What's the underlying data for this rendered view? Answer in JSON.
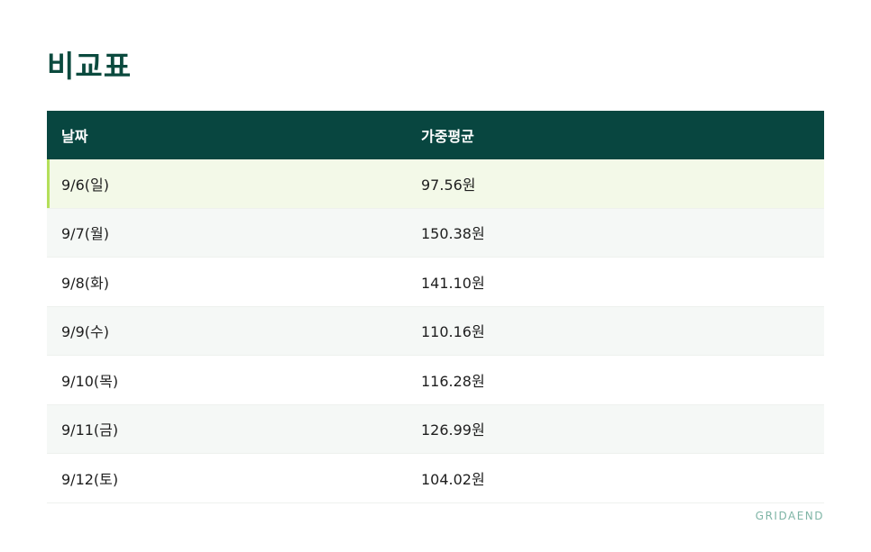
{
  "page": {
    "title": "비교표",
    "brand": "GRIDAEND"
  },
  "table": {
    "headers": {
      "date": "날짜",
      "avg": "가중평균"
    },
    "rows": [
      {
        "date": "9/6(일)",
        "avg": "97.56원"
      },
      {
        "date": "9/7(월)",
        "avg": "150.38원"
      },
      {
        "date": "9/8(화)",
        "avg": "141.10원"
      },
      {
        "date": "9/9(수)",
        "avg": "110.16원"
      },
      {
        "date": "9/10(목)",
        "avg": "116.28원"
      },
      {
        "date": "9/11(금)",
        "avg": "126.99원"
      },
      {
        "date": "9/12(토)",
        "avg": "104.02원"
      }
    ]
  },
  "colors": {
    "header_bg": "#084640",
    "title": "#0b4a3e",
    "highlight_bg": "#f3f9e8",
    "highlight_bar": "#b4df5a",
    "brand": "#7fb5a6"
  }
}
